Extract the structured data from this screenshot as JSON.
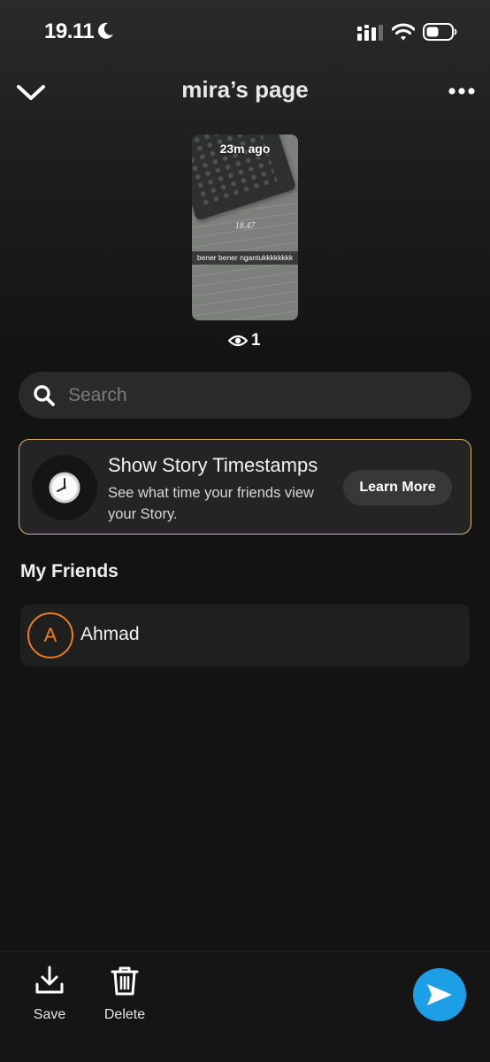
{
  "status_bar": {
    "time": "19.11",
    "icons": [
      "moon-icon",
      "signal-icon",
      "wifi-icon",
      "battery-icon"
    ]
  },
  "header": {
    "title": "mira’s page",
    "back_icon": "chevron-down-icon",
    "more_icon": "more-dots-icon"
  },
  "story": {
    "time_ago": "23m ago",
    "photo_time_text": "18.47",
    "caption": "bener bener ngantukkkkkkkk",
    "view_count": "1"
  },
  "search": {
    "placeholder": "Search"
  },
  "timestamp_card": {
    "title": "Show Story Timestamps",
    "description": "See what time your friends view your Story.",
    "button_label": "Learn More",
    "border_color": "#e0b66f"
  },
  "friends": {
    "section_title": "My Friends",
    "items": [
      {
        "initial": "A",
        "name": "Ahmad",
        "avatar_color": "#f07b1c"
      }
    ]
  },
  "bottom_bar": {
    "save_label": "Save",
    "delete_label": "Delete",
    "send_color": "#1d9fe8"
  }
}
